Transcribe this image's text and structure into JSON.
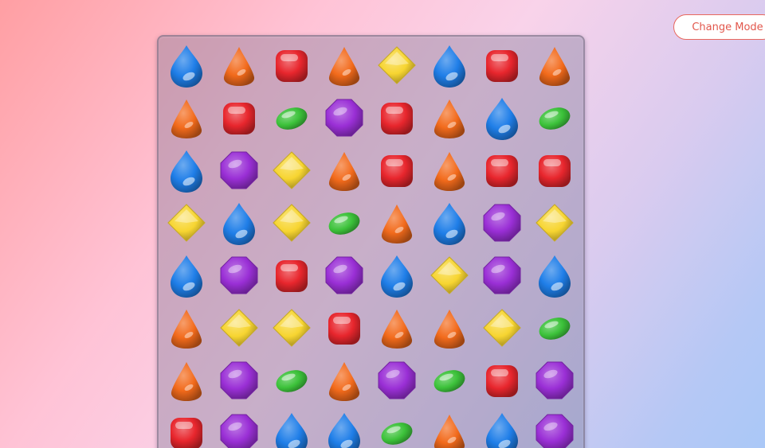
{
  "header": {
    "mode_button_label": "Change Mode"
  },
  "palette": {
    "blue": "#1f7ee8",
    "orange": "#f26a1b",
    "red": "#e8262d",
    "yellow": "#f7d531",
    "green": "#3cc23a",
    "purple": "#9a2fd6"
  },
  "board": {
    "rows": 8,
    "cols": 8,
    "candies": [
      [
        "blue-drop-candy-icon",
        "orange-cone-candy-icon",
        "red-square-candy-icon",
        "orange-cone-candy-icon",
        "yellow-diamond-candy-icon",
        "blue-drop-candy-icon",
        "red-square-candy-icon",
        "orange-cone-candy-icon"
      ],
      [
        "orange-cone-candy-icon",
        "red-square-candy-icon",
        "green-bean-candy-icon",
        "purple-octagon-candy-icon",
        "red-square-candy-icon",
        "orange-cone-candy-icon",
        "blue-drop-candy-icon",
        "green-bean-candy-icon"
      ],
      [
        "blue-drop-candy-icon",
        "purple-octagon-candy-icon",
        "yellow-diamond-candy-icon",
        "orange-cone-candy-icon",
        "red-square-candy-icon",
        "orange-cone-candy-icon",
        "red-square-candy-icon",
        "red-square-candy-icon"
      ],
      [
        "yellow-diamond-candy-icon",
        "blue-drop-candy-icon",
        "yellow-diamond-candy-icon",
        "green-bean-candy-icon",
        "orange-cone-candy-icon",
        "blue-drop-candy-icon",
        "purple-octagon-candy-icon",
        "yellow-diamond-candy-icon"
      ],
      [
        "blue-drop-candy-icon",
        "purple-octagon-candy-icon",
        "red-square-candy-icon",
        "purple-octagon-candy-icon",
        "blue-drop-candy-icon",
        "yellow-diamond-candy-icon",
        "purple-octagon-candy-icon",
        "blue-drop-candy-icon"
      ],
      [
        "orange-cone-candy-icon",
        "yellow-diamond-candy-icon",
        "yellow-diamond-candy-icon",
        "red-square-candy-icon",
        "orange-cone-candy-icon",
        "orange-cone-candy-icon",
        "yellow-diamond-candy-icon",
        "green-bean-candy-icon"
      ],
      [
        "orange-cone-candy-icon",
        "purple-octagon-candy-icon",
        "green-bean-candy-icon",
        "orange-cone-candy-icon",
        "purple-octagon-candy-icon",
        "green-bean-candy-icon",
        "red-square-candy-icon",
        "purple-octagon-candy-icon"
      ],
      [
        "red-square-candy-icon",
        "purple-octagon-candy-icon",
        "blue-drop-candy-icon",
        "blue-drop-candy-icon",
        "green-bean-candy-icon",
        "orange-cone-candy-icon",
        "blue-drop-candy-icon",
        "purple-octagon-candy-icon"
      ]
    ]
  }
}
